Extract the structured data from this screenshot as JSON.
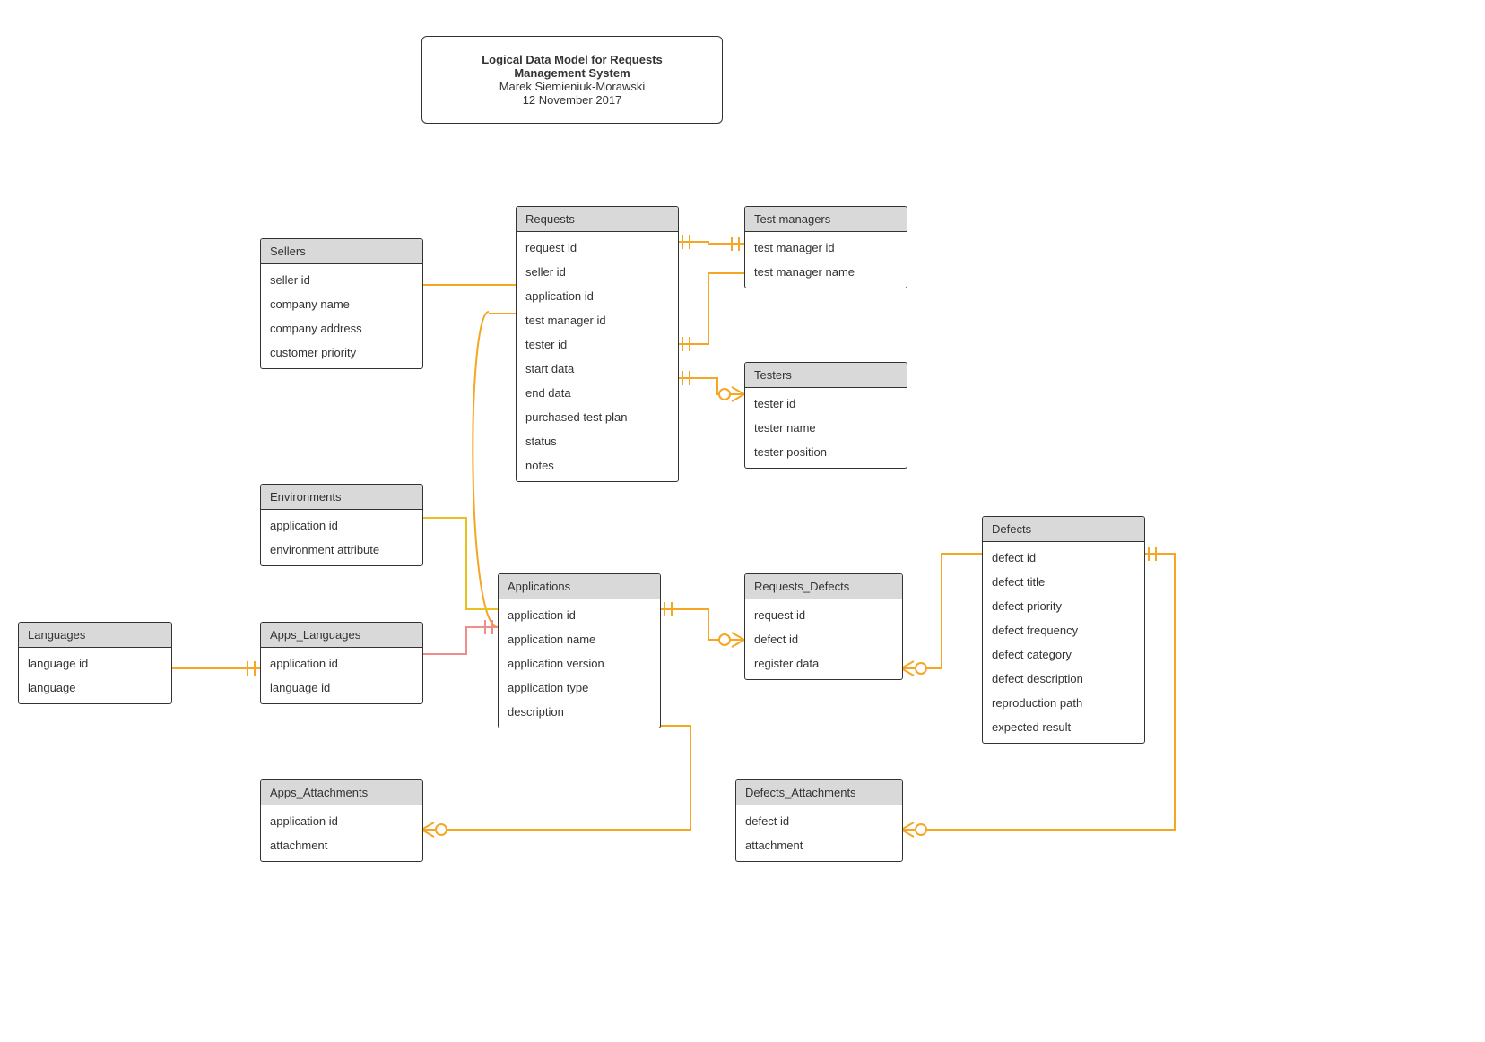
{
  "title_box": {
    "line1": "Logical Data Model for Requests",
    "line2": "Management System",
    "author": "Marek Siemieniuk-Morawski",
    "date": "12 November 2017"
  },
  "entities": {
    "sellers": {
      "name": "Sellers",
      "attrs": [
        "seller id",
        "company name",
        "company address",
        "customer priority"
      ]
    },
    "requests": {
      "name": "Requests",
      "attrs": [
        "request id",
        "seller id",
        "application id",
        "test manager id",
        "tester id",
        "start data",
        "end data",
        "purchased test plan",
        "status",
        "notes"
      ]
    },
    "test_managers": {
      "name": "Test managers",
      "attrs": [
        "test manager id",
        "test manager name"
      ]
    },
    "testers": {
      "name": "Testers",
      "attrs": [
        "tester id",
        "tester name",
        "tester position"
      ]
    },
    "environments": {
      "name": "Environments",
      "attrs": [
        "application id",
        "environment attribute"
      ]
    },
    "applications": {
      "name": "Applications",
      "attrs": [
        "application id",
        "application name",
        "application version",
        "application type",
        "description"
      ]
    },
    "requests_defects": {
      "name": "Requests_Defects",
      "attrs": [
        "request id",
        "defect id",
        "register data"
      ]
    },
    "defects": {
      "name": "Defects",
      "attrs": [
        "defect  id",
        "defect title",
        "defect priority",
        "defect frequency",
        "defect category",
        "defect description",
        "reproduction path",
        "expected result"
      ]
    },
    "languages": {
      "name": "Languages",
      "attrs": [
        "language id",
        "language"
      ]
    },
    "apps_languages": {
      "name": "Apps_Languages",
      "attrs": [
        "application id",
        "language id"
      ]
    },
    "apps_attachments": {
      "name": "Apps_Attachments",
      "attrs": [
        "application id",
        "attachment"
      ]
    },
    "defects_attachments": {
      "name": "Defects_Attachments",
      "attrs": [
        "defect id",
        "attachment"
      ]
    }
  },
  "colors": {
    "orange": "#f5a623",
    "yellow": "#e8c11c",
    "pink": "#f08c8c",
    "grey": "#333"
  }
}
